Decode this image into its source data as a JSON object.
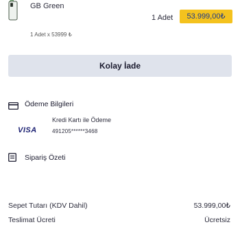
{
  "product": {
    "name": "GB Green",
    "quantity_label": "1 Adet",
    "price": "53.999,00₺",
    "quantity_detail": "1 Adet x 53999 ₺"
  },
  "actions": {
    "return_label": "Kolay İade"
  },
  "payment_section": {
    "title": "Ödeme Bilgileri",
    "icon": "credit-card-icon",
    "card_brand": "VISA",
    "card_title": "Kredi Kartı ile Ödeme",
    "card_number": "491205******3468"
  },
  "order_summary": {
    "title": "Sipariş Özeti",
    "icon": "receipt-icon",
    "lines": [
      {
        "label": "Sepet Tutarı (KDV Dahil)",
        "value": "53.999,00₺"
      },
      {
        "label": "Teslimat Ücreti",
        "value": "Ücretsiz"
      }
    ]
  },
  "colors": {
    "price_badge_bg": "#f4c21e",
    "price_text": "#1e3a8a",
    "button_bg": "#dfe3ec",
    "visa_blue": "#1a1f71"
  }
}
